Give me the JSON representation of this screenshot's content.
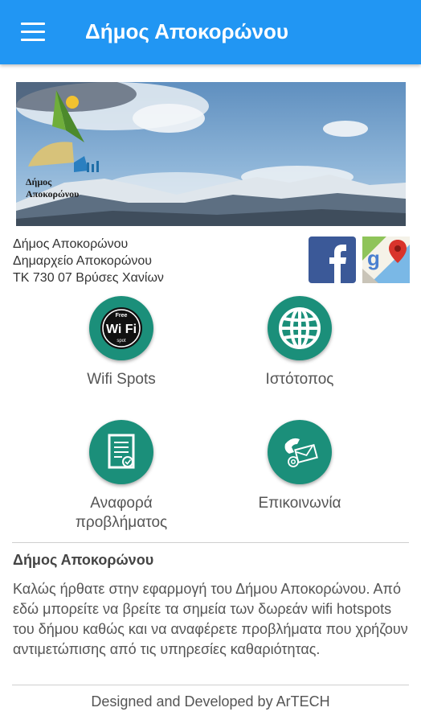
{
  "appbar": {
    "title": "Δήμος Αποκορώνου",
    "menu_icon": "hamburger-menu-icon"
  },
  "banner": {
    "logo_text_line1": "Δήμος",
    "logo_text_line2": "Αποκορώνου"
  },
  "address": {
    "line1": "Δήμος Αποκορώνου",
    "line2": "Δημαρχείο Αποκορώνου",
    "line3": "ΤΚ 730 07 Βρύσες Χανίων"
  },
  "social": {
    "facebook_icon": "facebook-icon",
    "maps_icon": "google-maps-icon"
  },
  "tiles": [
    {
      "label": "Wifi Spots",
      "icon": "wifi-icon",
      "icon_text_top": "Free",
      "icon_text_mid": "Wi Fi",
      "icon_text_bottom": "spot"
    },
    {
      "label": "Ιστότοπος",
      "icon": "globe-icon"
    },
    {
      "label_line1": "Αναφορά",
      "label_line2": "προβλήματος",
      "icon": "report-form-icon"
    },
    {
      "label": "Επικοινωνία",
      "icon": "contact-phone-mail-icon"
    }
  ],
  "welcome": {
    "title": "Δήμος Αποκορώνου",
    "text": "Καλώς ήρθατε στην εφαρμογή του Δήμου Αποκορώνου. Από εδώ μπορείτε να βρείτε τα σημεία των δωρεάν wifi hotspots του δήμου καθώς και να αναφέρετε προβλήματα που χρήζουν αντιμετώπισης από τις υπηρεσίες καθαριότητας."
  },
  "footer": {
    "text": "Designed and Developed by ArTECH"
  },
  "colors": {
    "appbar": "#2196F3",
    "tile_circle": "#1b8f7a",
    "facebook": "#3b5998"
  }
}
